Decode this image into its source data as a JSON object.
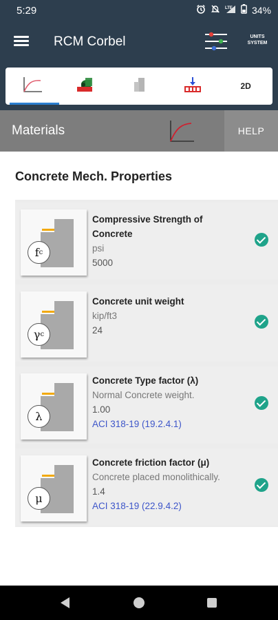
{
  "status": {
    "time": "5:29",
    "battery": "34%",
    "icons": [
      "alarm-icon",
      "mute-icon",
      "lte-signal-icon",
      "battery-icon"
    ]
  },
  "app": {
    "title": "RCM Corbel",
    "units_label_1": "UNITS",
    "units_label_2": "SYSTEM"
  },
  "tabs": [
    {
      "icon": "stress-strain-curve-icon",
      "active": true
    },
    {
      "icon": "corbel-load-icon",
      "active": false
    },
    {
      "icon": "corbel-shape-icon",
      "active": false
    },
    {
      "icon": "support-load-icon",
      "active": false
    },
    {
      "label": "2D",
      "active": false
    }
  ],
  "section": {
    "title": "Materials",
    "help_label": "HELP"
  },
  "group": {
    "title": "Concrete Mech. Properties"
  },
  "properties": [
    {
      "name": "Compressive Strength of Concrete",
      "unit": "psi",
      "value": "5000",
      "symbol": "f",
      "symbol_sub": "c",
      "status": "check-icon"
    },
    {
      "name": "Concrete unit weight",
      "unit": "kip/ft3",
      "value": "24",
      "symbol": "γ",
      "symbol_sub": "c",
      "status": "check-icon"
    },
    {
      "name": "Concrete Type factor (λ)",
      "description": "Normal Concrete weight.",
      "value": "1.00",
      "reference": "ACI 318-19 (19.2.4.1)",
      "symbol": "λ",
      "status": "check-icon"
    },
    {
      "name": "Concrete friction factor (μ)",
      "description": "Concrete placed monolithically.",
      "value": "1.4",
      "reference": "ACI 318-19 (22.9.4.2)",
      "symbol": "μ",
      "status": "check-icon"
    }
  ],
  "colors": {
    "app_bar": "#2d3e4e",
    "section_header": "#7d7d7d",
    "check": "#1fa38a",
    "link": "#3d55c9",
    "tab_indicator": "#2b7fd0"
  }
}
